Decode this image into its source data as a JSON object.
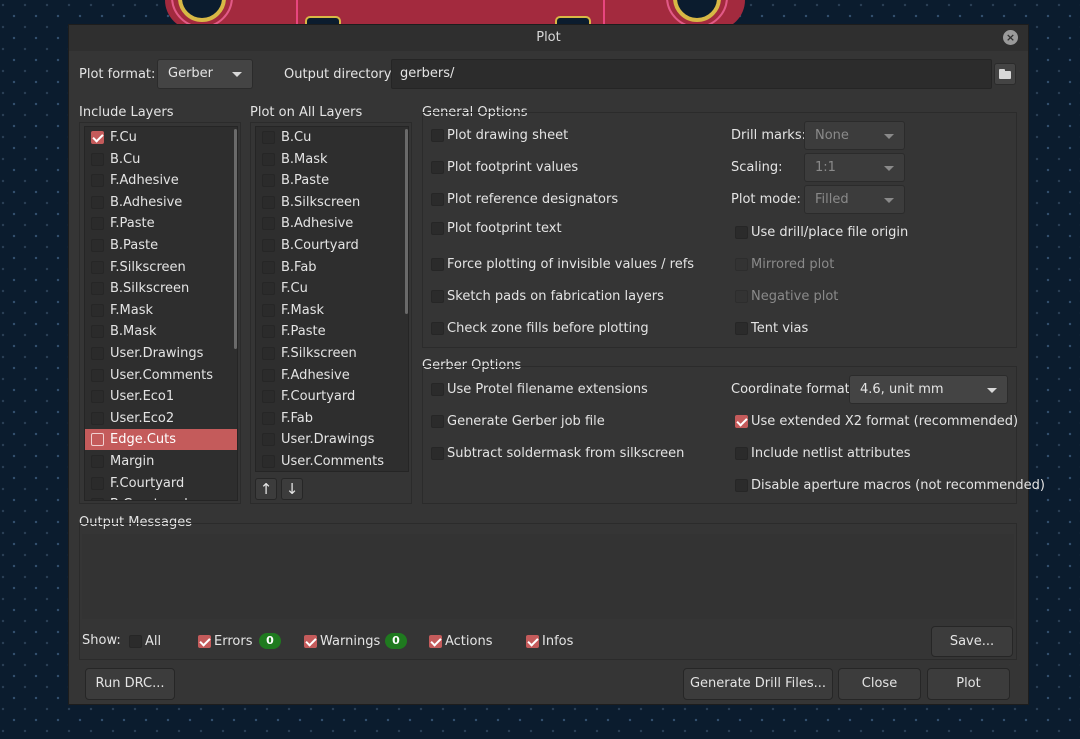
{
  "window": {
    "title": "Plot"
  },
  "toolbar": {
    "plot_format_label": "Plot format:",
    "plot_format_value": "Gerber",
    "output_dir_label": "Output directory:",
    "output_dir_value": "gerbers/"
  },
  "include_layers": {
    "title": "Include Layers",
    "items": [
      {
        "label": "F.Cu",
        "checked": true,
        "selected": false
      },
      {
        "label": "B.Cu",
        "checked": false,
        "selected": false
      },
      {
        "label": "F.Adhesive",
        "checked": false,
        "selected": false
      },
      {
        "label": "B.Adhesive",
        "checked": false,
        "selected": false
      },
      {
        "label": "F.Paste",
        "checked": false,
        "selected": false
      },
      {
        "label": "B.Paste",
        "checked": false,
        "selected": false
      },
      {
        "label": "F.Silkscreen",
        "checked": false,
        "selected": false
      },
      {
        "label": "B.Silkscreen",
        "checked": false,
        "selected": false
      },
      {
        "label": "F.Mask",
        "checked": false,
        "selected": false
      },
      {
        "label": "B.Mask",
        "checked": false,
        "selected": false
      },
      {
        "label": "User.Drawings",
        "checked": false,
        "selected": false
      },
      {
        "label": "User.Comments",
        "checked": false,
        "selected": false
      },
      {
        "label": "User.Eco1",
        "checked": false,
        "selected": false
      },
      {
        "label": "User.Eco2",
        "checked": false,
        "selected": false
      },
      {
        "label": "Edge.Cuts",
        "checked": false,
        "selected": true
      },
      {
        "label": "Margin",
        "checked": false,
        "selected": false
      },
      {
        "label": "F.Courtyard",
        "checked": false,
        "selected": false
      },
      {
        "label": "B.Courtyard",
        "checked": false,
        "selected": false
      }
    ]
  },
  "all_layers": {
    "title": "Plot on All Layers",
    "items": [
      {
        "label": "B.Cu",
        "checked": false
      },
      {
        "label": "B.Mask",
        "checked": false
      },
      {
        "label": "B.Paste",
        "checked": false
      },
      {
        "label": "B.Silkscreen",
        "checked": false
      },
      {
        "label": "B.Adhesive",
        "checked": false
      },
      {
        "label": "B.Courtyard",
        "checked": false
      },
      {
        "label": "B.Fab",
        "checked": false
      },
      {
        "label": "F.Cu",
        "checked": false
      },
      {
        "label": "F.Mask",
        "checked": false
      },
      {
        "label": "F.Paste",
        "checked": false
      },
      {
        "label": "F.Silkscreen",
        "checked": false
      },
      {
        "label": "F.Adhesive",
        "checked": false
      },
      {
        "label": "F.Courtyard",
        "checked": false
      },
      {
        "label": "F.Fab",
        "checked": false
      },
      {
        "label": "User.Drawings",
        "checked": false
      },
      {
        "label": "User.Comments",
        "checked": false
      }
    ],
    "move_up_icon": "↑",
    "move_down_icon": "↓"
  },
  "general": {
    "title": "General Options",
    "plot_drawing_sheet": "Plot drawing sheet",
    "plot_footprint_values": "Plot footprint values",
    "plot_reference_designators": "Plot reference designators",
    "plot_footprint_text": "Plot footprint text",
    "force_invisible": "Force plotting of invisible values / refs",
    "sketch_pads": "Sketch pads on fabrication layers",
    "check_zone_fills": "Check zone fills before plotting",
    "drill_marks_label": "Drill marks:",
    "drill_marks_value": "None",
    "scaling_label": "Scaling:",
    "scaling_value": "1:1",
    "plot_mode_label": "Plot mode:",
    "plot_mode_value": "Filled",
    "use_drill_origin": "Use drill/place file origin",
    "mirrored_plot": "Mirrored plot",
    "negative_plot": "Negative plot",
    "tent_vias": "Tent vias"
  },
  "gerber": {
    "title": "Gerber Options",
    "protel_ext": "Use Protel filename extensions",
    "job_file": "Generate Gerber job file",
    "subtract_mask": "Subtract soldermask from silkscreen",
    "coord_format_label": "Coordinate format:",
    "coord_format_value": "4.6, unit mm",
    "x2_format": "Use extended X2 format (recommended)",
    "x2_checked": true,
    "netlist_attrs": "Include netlist attributes",
    "disable_aperture": "Disable aperture macros (not recommended)"
  },
  "messages": {
    "title": "Output Messages",
    "show_label": "Show:",
    "all_label": "All",
    "errors_label": "Errors",
    "errors_count": "0",
    "warnings_label": "Warnings",
    "warnings_count": "0",
    "actions_label": "Actions",
    "infos_label": "Infos",
    "save_label": "Save..."
  },
  "footer": {
    "run_drc": "Run DRC...",
    "generate_drill": "Generate Drill Files...",
    "close": "Close",
    "plot": "Plot"
  },
  "colors": {
    "accent": "#c45b5b",
    "badge": "#1f7a1f",
    "dialog_bg": "#353535"
  }
}
